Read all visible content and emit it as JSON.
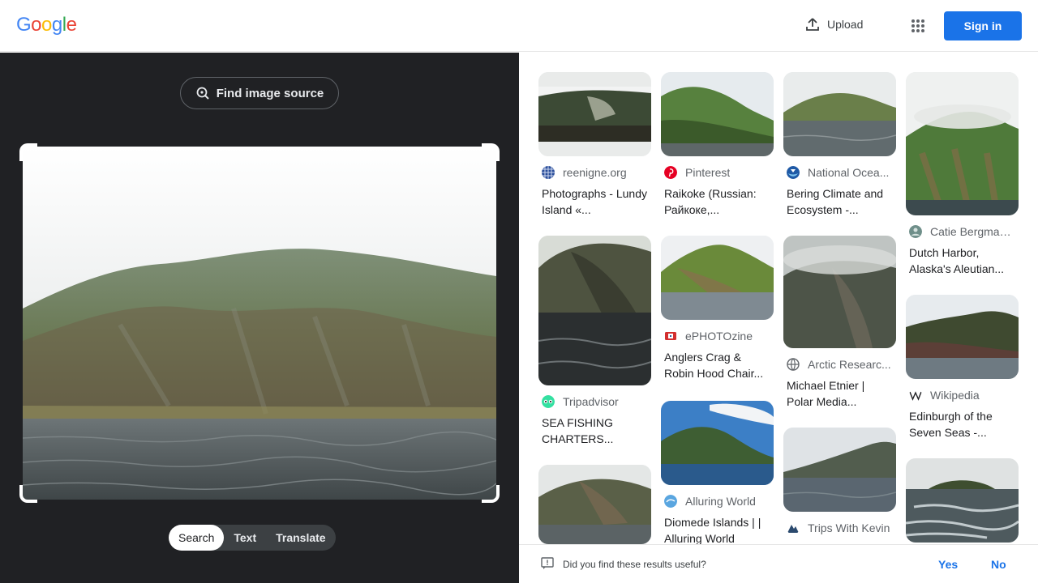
{
  "header": {
    "logo_letters": [
      "G",
      "o",
      "o",
      "g",
      "l",
      "e"
    ],
    "logo_colors": [
      "#4285f4",
      "#ea4335",
      "#fbbc05",
      "#4285f4",
      "#34a853",
      "#ea4335"
    ],
    "upload_label": "Upload",
    "apps_icon": "apps-grid-icon",
    "signin_label": "Sign in"
  },
  "left_panel": {
    "find_source_label": "Find image source",
    "tabs": [
      {
        "label": "Search",
        "active": true
      },
      {
        "label": "Text",
        "active": false
      },
      {
        "label": "Translate",
        "active": false
      }
    ]
  },
  "results": [
    {
      "source": "reenigne.org",
      "title": "Photographs - Lundy Island «...",
      "favicon": "grid-favicon-icon"
    },
    {
      "source": "Pinterest",
      "title": "Raikoke (Russian: Райкоке,...",
      "favicon": "pinterest-icon"
    },
    {
      "source": "National Ocea...",
      "title": "Bering Climate and Ecosystem -...",
      "favicon": "noaa-icon"
    },
    {
      "source": "Catie Bergman...",
      "title": "Dutch Harbor, Alaska's Aleutian...",
      "favicon": "person-icon"
    },
    {
      "source": "Tripadvisor",
      "title": "SEA FISHING CHARTERS...",
      "favicon": "tripadvisor-icon"
    },
    {
      "source": "ePHOTOzine",
      "title": "Anglers Crag & Robin Hood Chair...",
      "favicon": "ephotozine-icon"
    },
    {
      "source": "Arctic Researc...",
      "title": "Michael Etnier | Polar Media...",
      "favicon": "globe-icon"
    },
    {
      "source": "Wikipedia",
      "title": "Edinburgh of the Seven Seas -...",
      "favicon": "wikipedia-icon"
    },
    {
      "source": "",
      "title": "",
      "favicon": ""
    },
    {
      "source": "Alluring World",
      "title": "Diomede Islands | | Alluring World",
      "favicon": "alluring-world-icon"
    },
    {
      "source": "Trips With Kevin",
      "title": "",
      "favicon": "trips-with-kevin-icon"
    },
    {
      "source": "",
      "title": "",
      "favicon": ""
    }
  ],
  "feedback": {
    "question": "Did you find these results useful?",
    "yes_label": "Yes",
    "no_label": "No"
  }
}
